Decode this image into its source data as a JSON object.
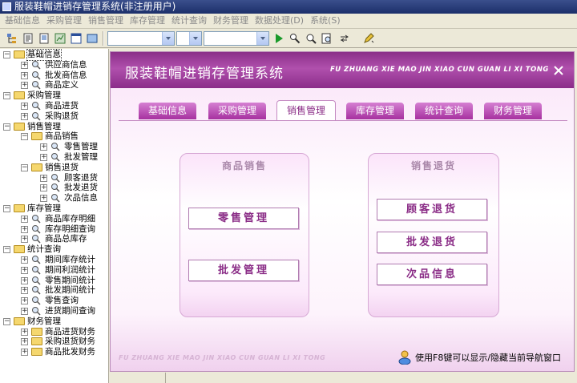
{
  "window": {
    "title": "服装鞋帽进销存管理系统(非注册用户)"
  },
  "menu": [
    "基础信息",
    "采购管理",
    "销售管理",
    "库存管理",
    "统计查询",
    "财务管理",
    "数据处理(D)",
    "系统(S)"
  ],
  "toolbar": {
    "select1_value": "",
    "select2_value": "",
    "select3_value": ""
  },
  "tree": [
    {
      "label": "基础信息",
      "level": 0,
      "type": "folder",
      "expanded": true,
      "selected": true
    },
    {
      "label": "供应商信息",
      "level": 1,
      "type": "leaf"
    },
    {
      "label": "批发商信息",
      "level": 1,
      "type": "leaf"
    },
    {
      "label": "商品定义",
      "level": 1,
      "type": "leaf"
    },
    {
      "label": "采购管理",
      "level": 0,
      "type": "folder",
      "expanded": true
    },
    {
      "label": "商品进货",
      "level": 1,
      "type": "leaf"
    },
    {
      "label": "采购退货",
      "level": 1,
      "type": "leaf"
    },
    {
      "label": "销售管理",
      "level": 0,
      "type": "folder",
      "expanded": true
    },
    {
      "label": "商品销售",
      "level": 1,
      "type": "folder",
      "expanded": true
    },
    {
      "label": "零售管理",
      "level": 2,
      "type": "leaf"
    },
    {
      "label": "批发管理",
      "level": 2,
      "type": "leaf"
    },
    {
      "label": "销售退货",
      "level": 1,
      "type": "folder",
      "expanded": true
    },
    {
      "label": "顾客退货",
      "level": 2,
      "type": "leaf"
    },
    {
      "label": "批发退货",
      "level": 2,
      "type": "leaf"
    },
    {
      "label": "次品信息",
      "level": 2,
      "type": "leaf"
    },
    {
      "label": "库存管理",
      "level": 0,
      "type": "folder",
      "expanded": true
    },
    {
      "label": "商品库存明细",
      "level": 1,
      "type": "leaf"
    },
    {
      "label": "库存明细查询",
      "level": 1,
      "type": "leaf"
    },
    {
      "label": "商品总库存",
      "level": 1,
      "type": "leaf"
    },
    {
      "label": "统计查询",
      "level": 0,
      "type": "folder",
      "expanded": true
    },
    {
      "label": "期间库存统计",
      "level": 1,
      "type": "leaf"
    },
    {
      "label": "期间利润统计",
      "level": 1,
      "type": "leaf"
    },
    {
      "label": "零售期间统计",
      "level": 1,
      "type": "leaf"
    },
    {
      "label": "批发期间统计",
      "level": 1,
      "type": "leaf"
    },
    {
      "label": "零售查询",
      "level": 1,
      "type": "leaf"
    },
    {
      "label": "进货期间查询",
      "level": 1,
      "type": "leaf"
    },
    {
      "label": "财务管理",
      "level": 0,
      "type": "folder",
      "expanded": true
    },
    {
      "label": "商品进货财务",
      "level": 1,
      "type": "folder",
      "expanded": false
    },
    {
      "label": "采购退货财务",
      "level": 1,
      "type": "folder",
      "expanded": false
    },
    {
      "label": "商品批发财务",
      "level": 1,
      "type": "folder",
      "expanded": false
    }
  ],
  "main": {
    "title": "服装鞋帽进销存管理系统",
    "subtitle": "FU ZHUANG XIE MAO JIN XIAO CUN GUAN LI XI TONG",
    "close_label": "×",
    "tabs": [
      "基础信息",
      "采购管理",
      "销售管理",
      "库存管理",
      "统计查询",
      "财务管理"
    ],
    "active_tab": "销售管理",
    "groups": {
      "sales": {
        "title": "商品销售",
        "buttons": [
          "零售管理",
          "批发管理"
        ]
      },
      "returns": {
        "title": "销售退货",
        "buttons": [
          "顾客退货",
          "批发退货",
          "次品信息"
        ]
      }
    },
    "footer_text": "FU ZHUANG XIE MAO JIN XIAO CUN GUAN LI XI TONG",
    "footer_hint": "使用F8键可以显示/隐藏当前导航窗口"
  },
  "colors": {
    "header": "#9b3b98",
    "tab": "#b13fab",
    "accent_text": "#8a2c86"
  }
}
